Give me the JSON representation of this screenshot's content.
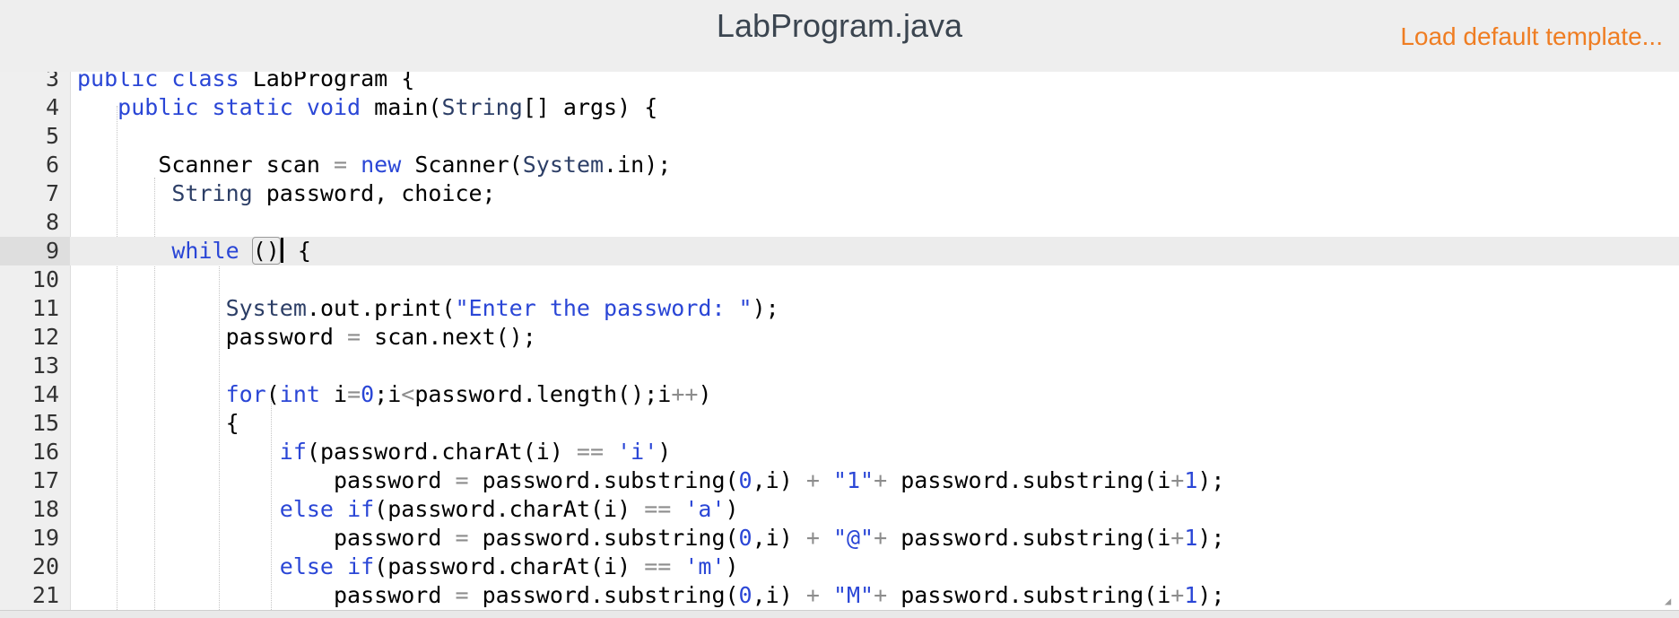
{
  "header": {
    "file_title": "LabProgram.java",
    "load_template_label": "Load default template..."
  },
  "editor": {
    "active_line": 9,
    "line_numbers": [
      "3",
      "4",
      "5",
      "6",
      "7",
      "8",
      "9",
      "10",
      "11",
      "12",
      "13",
      "14",
      "15",
      "16",
      "17",
      "18",
      "19",
      "20",
      "21"
    ],
    "tokens": {
      "l3_public": "public",
      "l3_class": "class",
      "l3_rest": " LabProgram {",
      "l4_public": "public",
      "l4_static": "static",
      "l4_void": "void",
      "l4_main": " main(",
      "l4_String": "String",
      "l4_rest": "[] args) {",
      "l6_Scanner": "Scanner scan ",
      "l6_eq": "=",
      "l6_new": "new",
      "l6_Scanner2": " Scanner(",
      "l6_System": "System",
      "l6_rest": ".in);",
      "l7_String": "String",
      "l7_rest": " password, choice;",
      "l9_while": "while",
      "l9_open": "(",
      "l9_close": ")",
      "l9_rest": " {",
      "l11_System": "System",
      "l11_mid": ".out.print(",
      "l11_str": "\"Enter the password: \"",
      "l11_rest": ");",
      "l12_a": "password ",
      "l12_eq": "=",
      "l12_rest": " scan.next();",
      "l14_for": "for",
      "l14_p": "(",
      "l14_int": "int",
      "l14_i": " i",
      "l14_eq": "=",
      "l14_zero": "0",
      "l14_semi": ";i",
      "l14_lt": "<",
      "l14_mid": "password.length();i",
      "l14_pp": "++",
      "l14_rest": ")",
      "l15_brace": "{",
      "l16_if": "if",
      "l16_mid": "(password.charAt(i) ",
      "l16_eq": "==",
      "l16_chr": "'i'",
      "l16_rest": ")",
      "l17_a": "password ",
      "l17_eq": "=",
      "l17_b": " password.substring(",
      "l17_zero": "0",
      "l17_c": ",i) ",
      "l17_plus": "+",
      "l17_str": "\"1\"",
      "l17_plus2": "+",
      "l17_d": " password.substring(i",
      "l17_plus3": "+",
      "l17_one": "1",
      "l17_rest": ");",
      "l18_else": "else",
      "l18_if": "if",
      "l18_mid": "(password.charAt(i) ",
      "l18_eq": "==",
      "l18_chr": "'a'",
      "l18_rest": ")",
      "l19_a": "password ",
      "l19_eq": "=",
      "l19_b": " password.substring(",
      "l19_zero": "0",
      "l19_c": ",i) ",
      "l19_plus": "+",
      "l19_str": "\"@\"",
      "l19_plus2": "+",
      "l19_d": " password.substring(i",
      "l19_plus3": "+",
      "l19_one": "1",
      "l19_rest": ");",
      "l20_else": "else",
      "l20_if": "if",
      "l20_mid": "(password.charAt(i) ",
      "l20_eq": "==",
      "l20_chr": "'m'",
      "l20_rest": ")",
      "l21_a": "password ",
      "l21_eq": "=",
      "l21_b": " password.substring(",
      "l21_zero": "0",
      "l21_c": ",i) ",
      "l21_plus": "+",
      "l21_str": "\"M\"",
      "l21_plus2": "+",
      "l21_d": " password.substring(i",
      "l21_plus3": "+",
      "l21_one": "1",
      "l21_rest": ");"
    }
  },
  "colors": {
    "keyword": "#2a46d6",
    "type": "#2c3e66",
    "operator": "#8d8d8d",
    "link": "#ef7d22",
    "title": "#3b4550"
  }
}
